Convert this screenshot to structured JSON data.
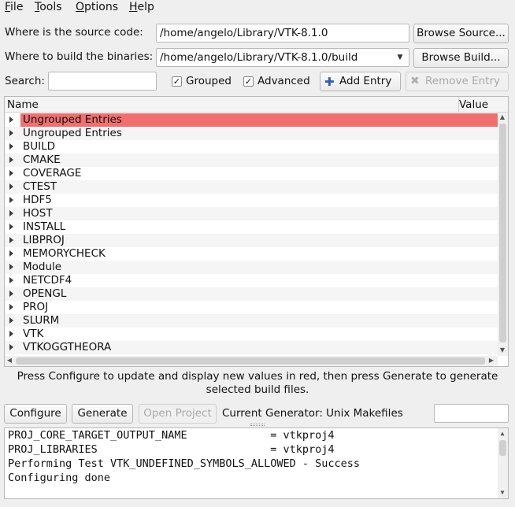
{
  "menu": [
    "File",
    "Tools",
    "Options",
    "Help"
  ],
  "source": {
    "label": "Where is the source code:",
    "value": "/home/angelo/Library/VTK-8.1.0",
    "browse_label": "Browse Source..."
  },
  "build": {
    "label": "Where to build the binaries:",
    "value": "/home/angelo/Library/VTK-8.1.0/build",
    "browse_label": "Browse Build..."
  },
  "search": {
    "label": "Search:",
    "value": ""
  },
  "options": {
    "grouped_label": "Grouped",
    "grouped_checked": true,
    "advanced_label": "Advanced",
    "advanced_checked": true,
    "add_entry_label": "Add Entry",
    "remove_entry_label": "Remove Entry"
  },
  "tree": {
    "columns": [
      "Name",
      "Value"
    ],
    "rows": [
      {
        "name": "Ungrouped Entries",
        "selected": true
      },
      {
        "name": "Ungrouped Entries",
        "selected": false
      },
      {
        "name": "BUILD",
        "selected": false
      },
      {
        "name": "CMAKE",
        "selected": false
      },
      {
        "name": "COVERAGE",
        "selected": false
      },
      {
        "name": "CTEST",
        "selected": false
      },
      {
        "name": "HDF5",
        "selected": false
      },
      {
        "name": "HOST",
        "selected": false
      },
      {
        "name": "INSTALL",
        "selected": false
      },
      {
        "name": "LIBPROJ",
        "selected": false
      },
      {
        "name": "MEMORYCHECK",
        "selected": false
      },
      {
        "name": "Module",
        "selected": false
      },
      {
        "name": "NETCDF4",
        "selected": false
      },
      {
        "name": "OPENGL",
        "selected": false
      },
      {
        "name": "PROJ",
        "selected": false
      },
      {
        "name": "SLURM",
        "selected": false
      },
      {
        "name": "VTK",
        "selected": false
      },
      {
        "name": "VTKOGGTHEORA",
        "selected": false
      }
    ],
    "highlight_color": "#f07070"
  },
  "info": {
    "line1": "Press Configure to update and display new values in red, then press Generate to generate",
    "line2": "selected build files."
  },
  "actions": {
    "configure_label": "Configure",
    "generate_label": "Generate",
    "open_project_label": "Open Project",
    "generator_text": "Current Generator: Unix Makefiles"
  },
  "output": [
    "PROJ_CORE_TARGET_OUTPUT_NAME             = vtkproj4",
    "PROJ_LIBRARIES                           = vtkproj4",
    "Performing Test VTK_UNDEFINED_SYMBOLS_ALLOWED - Success",
    "Configuring done"
  ]
}
